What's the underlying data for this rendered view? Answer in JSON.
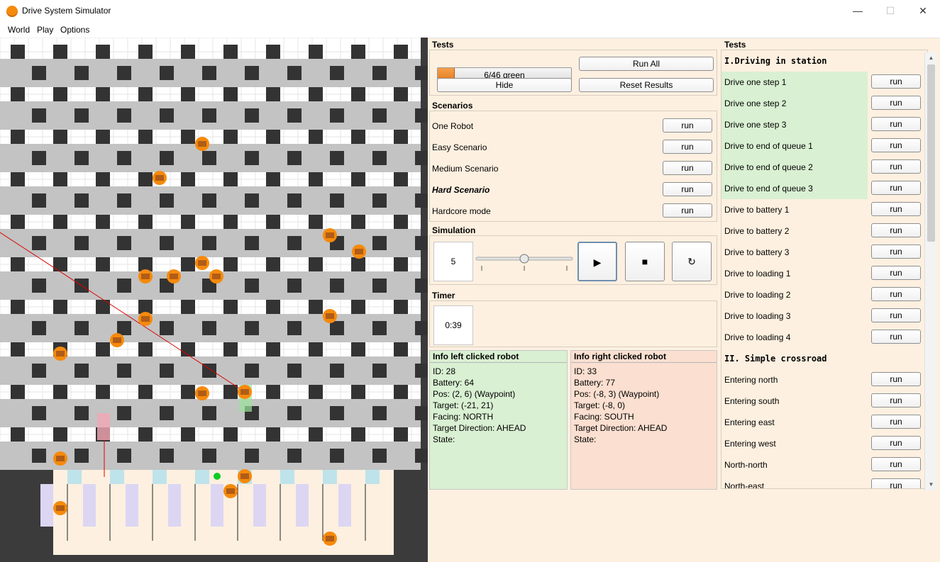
{
  "window": {
    "title": "Drive System Simulator",
    "minimize": "—",
    "maximize": "☐",
    "close": "✕"
  },
  "menu": [
    "World",
    "Play",
    "Options"
  ],
  "controls": {
    "tests_title": "Tests",
    "progress": {
      "text": "6/46 green",
      "fraction": 0.13
    },
    "run_all": "Run All",
    "hide": "Hide",
    "reset_results": "Reset Results"
  },
  "scenarios": {
    "title": "Scenarios",
    "items": [
      {
        "label": "One Robot",
        "button": "run",
        "emphasis": false
      },
      {
        "label": "Easy Scenario",
        "button": "run",
        "emphasis": false
      },
      {
        "label": "Medium Scenario",
        "button": "run",
        "emphasis": false
      },
      {
        "label": "Hard Scenario",
        "button": "run",
        "emphasis": true
      },
      {
        "label": "Hardcore mode",
        "button": "run",
        "emphasis": false
      }
    ]
  },
  "simulation": {
    "title": "Simulation",
    "speed": "5",
    "slider_fraction": 0.5,
    "play_icon": "play-icon",
    "stop_icon": "stop-icon",
    "reset_icon": "reset-icon"
  },
  "timer": {
    "title": "Timer",
    "value": "0:39"
  },
  "info_left": {
    "title": "Info left clicked robot",
    "color": "#d9f0d2",
    "lines": [
      "ID: 28",
      "Battery: 64",
      "Pos: (2, 6) (Waypoint)",
      "Target: (-21, 21)",
      "Facing: NORTH",
      "Target Direction: AHEAD",
      "State:"
    ]
  },
  "info_right": {
    "title": "Info right clicked robot",
    "color": "#fbdfd0",
    "lines": [
      "ID: 33",
      "Battery: 77",
      "Pos: (-8, 3) (Waypoint)",
      "Target: (-8, 0)",
      "Facing: SOUTH",
      "Target Direction: AHEAD",
      "State:"
    ]
  },
  "tests_list": {
    "title": "Tests",
    "groups": [
      {
        "name": "I.Driving in station",
        "tests": [
          {
            "label": "Drive one step 1",
            "button": "run",
            "passed": true
          },
          {
            "label": "Drive one step 2",
            "button": "run",
            "passed": true
          },
          {
            "label": "Drive one step 3",
            "button": "run",
            "passed": true
          },
          {
            "label": "Drive to end of queue 1",
            "button": "run",
            "passed": true
          },
          {
            "label": "Drive to end of queue 2",
            "button": "run",
            "passed": true
          },
          {
            "label": "Drive to end of queue 3",
            "button": "run",
            "passed": true
          },
          {
            "label": "Drive to battery 1",
            "button": "run",
            "passed": false
          },
          {
            "label": "Drive to battery 2",
            "button": "run",
            "passed": false
          },
          {
            "label": "Drive to battery 3",
            "button": "run",
            "passed": false
          },
          {
            "label": "Drive to loading 1",
            "button": "run",
            "passed": false
          },
          {
            "label": "Drive to loading 2",
            "button": "run",
            "passed": false
          },
          {
            "label": "Drive to loading 3",
            "button": "run",
            "passed": false
          },
          {
            "label": "Drive to loading 4",
            "button": "run",
            "passed": false
          }
        ]
      },
      {
        "name": "II. Simple crossroad",
        "tests": [
          {
            "label": "Entering north",
            "button": "run",
            "passed": false
          },
          {
            "label": "Entering south",
            "button": "run",
            "passed": false
          },
          {
            "label": "Entering east",
            "button": "run",
            "passed": false
          },
          {
            "label": "Entering west",
            "button": "run",
            "passed": false
          },
          {
            "label": "North-north",
            "button": "run",
            "passed": false
          },
          {
            "label": "North-east",
            "button": "run",
            "passed": false
          }
        ]
      }
    ]
  },
  "colors": {
    "robot": "#f58a0c",
    "panel_bg": "#fdf0e0",
    "passed": "#d9f0d2",
    "path_line": "#dd0000"
  }
}
